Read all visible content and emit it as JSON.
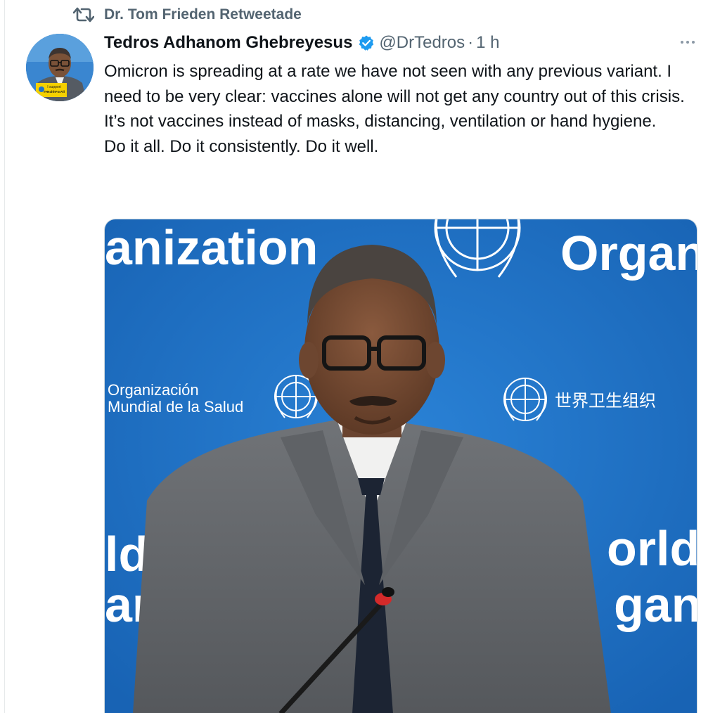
{
  "retweet": {
    "icon": "retweet-icon",
    "label": "Dr. Tom Frieden Retweetade"
  },
  "tweet": {
    "author_name": "Tedros Adhanom Ghebreyesus",
    "verified_icon": "verified-badge-icon",
    "handle": "@DrTedros",
    "separator": "·",
    "time": "1 h",
    "more_icon": "more-options-icon",
    "text_lines": [
      "Omicron is spreading at a rate we have not seen with any previous variant. I need to be very clear: vaccines alone will not get any country out of this crisis.",
      "It’s not vaccines instead of masks, distancing, ventilation or hand hygiene.",
      "Do it all. Do it consistently. Do it well."
    ],
    "avatar": {
      "badge_line1": "I support",
      "badge_line2": "#HealthForAll"
    }
  },
  "media": {
    "backdrop_words": {
      "top_left": "anization",
      "top_right": "Organ",
      "spanish_line1": "Organización",
      "spanish_line2": "Mundial de la Salud",
      "chinese": "世界卫生组织",
      "lower_left_1": "ld H",
      "lower_left_2": "ani",
      "lower_right_1": "orld",
      "lower_right_2": "gani"
    }
  },
  "colors": {
    "backdrop_blue": "#1f73c9",
    "text_primary": "#0f1419",
    "text_secondary": "#536471",
    "verified_blue": "#1d9bf0"
  }
}
